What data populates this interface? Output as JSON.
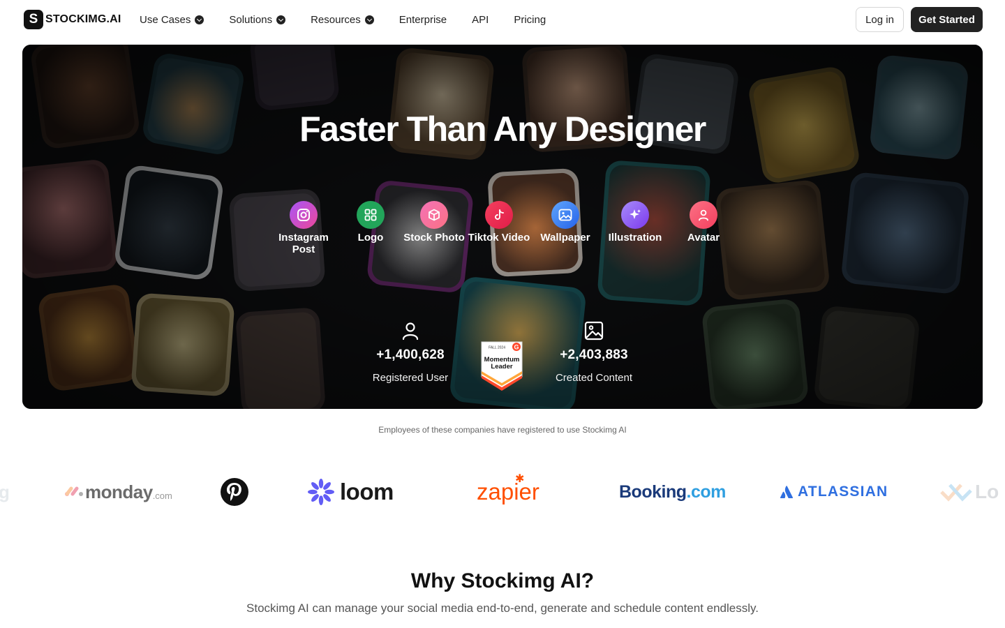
{
  "nav": {
    "logo_mark": "S",
    "logo_text": "STOCKIMG.AI",
    "menu": [
      {
        "label": "Use Cases",
        "has_dropdown": true
      },
      {
        "label": "Solutions",
        "has_dropdown": true
      },
      {
        "label": "Resources",
        "has_dropdown": true
      },
      {
        "label": "Enterprise",
        "has_dropdown": false
      },
      {
        "label": "API",
        "has_dropdown": false
      },
      {
        "label": "Pricing",
        "has_dropdown": false
      }
    ],
    "login_label": "Log in",
    "start_label": "Get Started"
  },
  "hero": {
    "title": "Faster Than Any Designer",
    "categories": [
      {
        "label": "Instagram Post",
        "icon": "instagram-icon",
        "color": "#d63aa6"
      },
      {
        "label": "Logo",
        "icon": "grid-icon",
        "color": "#22a55a"
      },
      {
        "label": "Stock Photo",
        "icon": "box-icon",
        "color": "#f05a8c"
      },
      {
        "label": "Tiktok Video",
        "icon": "tiktok-icon",
        "color": "#e8335a"
      },
      {
        "label": "Wallpaper",
        "icon": "image-icon",
        "color": "#3b82f6"
      },
      {
        "label": "Illustration",
        "icon": "sparkle-icon",
        "color": "#8b5cf6"
      },
      {
        "label": "Avatar",
        "icon": "user-icon",
        "color": "#f0607a"
      }
    ],
    "stats": [
      {
        "value": "+1,400,628",
        "label": "Registered User",
        "icon": "user-icon"
      },
      {
        "value": "+2,403,883",
        "label": "Created Content",
        "icon": "image-icon"
      }
    ],
    "badge": {
      "season": "FALL 2024",
      "title_line1": "Momentum",
      "title_line2": "Leader",
      "brand": "G",
      "accent": "#ff492c"
    }
  },
  "companies": {
    "caption": "Employees of these companies have registered to use Stockimg AI",
    "brands": [
      "monday.com",
      "Pinterest",
      "loom",
      "zapier",
      "Booking.com",
      "ATLASSIAN",
      "Lo"
    ],
    "monday_name": "monday",
    "monday_suffix": ".com",
    "booking_name": "Booking",
    "booking_suffix": ".com"
  },
  "why": {
    "title": "Why Stockimg AI?",
    "subtitle": "Stockimg AI can manage your social media end-to-end, generate and schedule content endlessly."
  }
}
